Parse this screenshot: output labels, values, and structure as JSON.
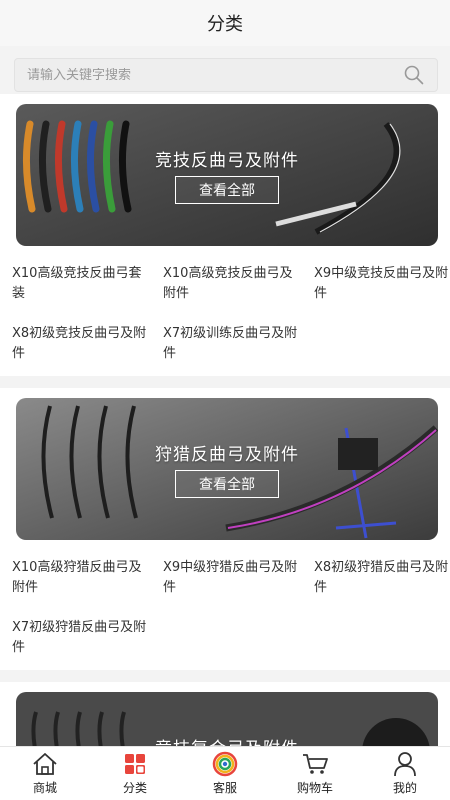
{
  "header": {
    "title": "分类"
  },
  "search": {
    "placeholder": "请输入关键字搜索",
    "icon": "search-icon"
  },
  "sections": [
    {
      "banner_title": "竞技反曲弓及附件",
      "view_all": "查看全部",
      "items": [
        "X10高级竞技反曲弓套装",
        "X10高级竞技反曲弓及附件",
        "X9中级竞技反曲弓及附件",
        "X8初级竞技反曲弓及附件",
        "X7初级训练反曲弓及附件"
      ]
    },
    {
      "banner_title": "狩猎反曲弓及附件",
      "view_all": "查看全部",
      "items": [
        "X10高级狩猎反曲弓及附件",
        "X9中级狩猎反曲弓及附件",
        "X8初级狩猎反曲弓及附件",
        "X7初级狩猎反曲弓及附件"
      ]
    },
    {
      "banner_title": "竞技复合弓及附件"
    }
  ],
  "tabbar": [
    {
      "label": "商城",
      "icon": "home-icon"
    },
    {
      "label": "分类",
      "icon": "category-icon",
      "active": true
    },
    {
      "label": "客服",
      "icon": "customer-service-icon"
    },
    {
      "label": "购物车",
      "icon": "cart-icon"
    },
    {
      "label": "我的",
      "icon": "profile-icon"
    }
  ],
  "colors": {
    "accent": "#e8453c",
    "banner_bg": "#4a4a4a"
  }
}
